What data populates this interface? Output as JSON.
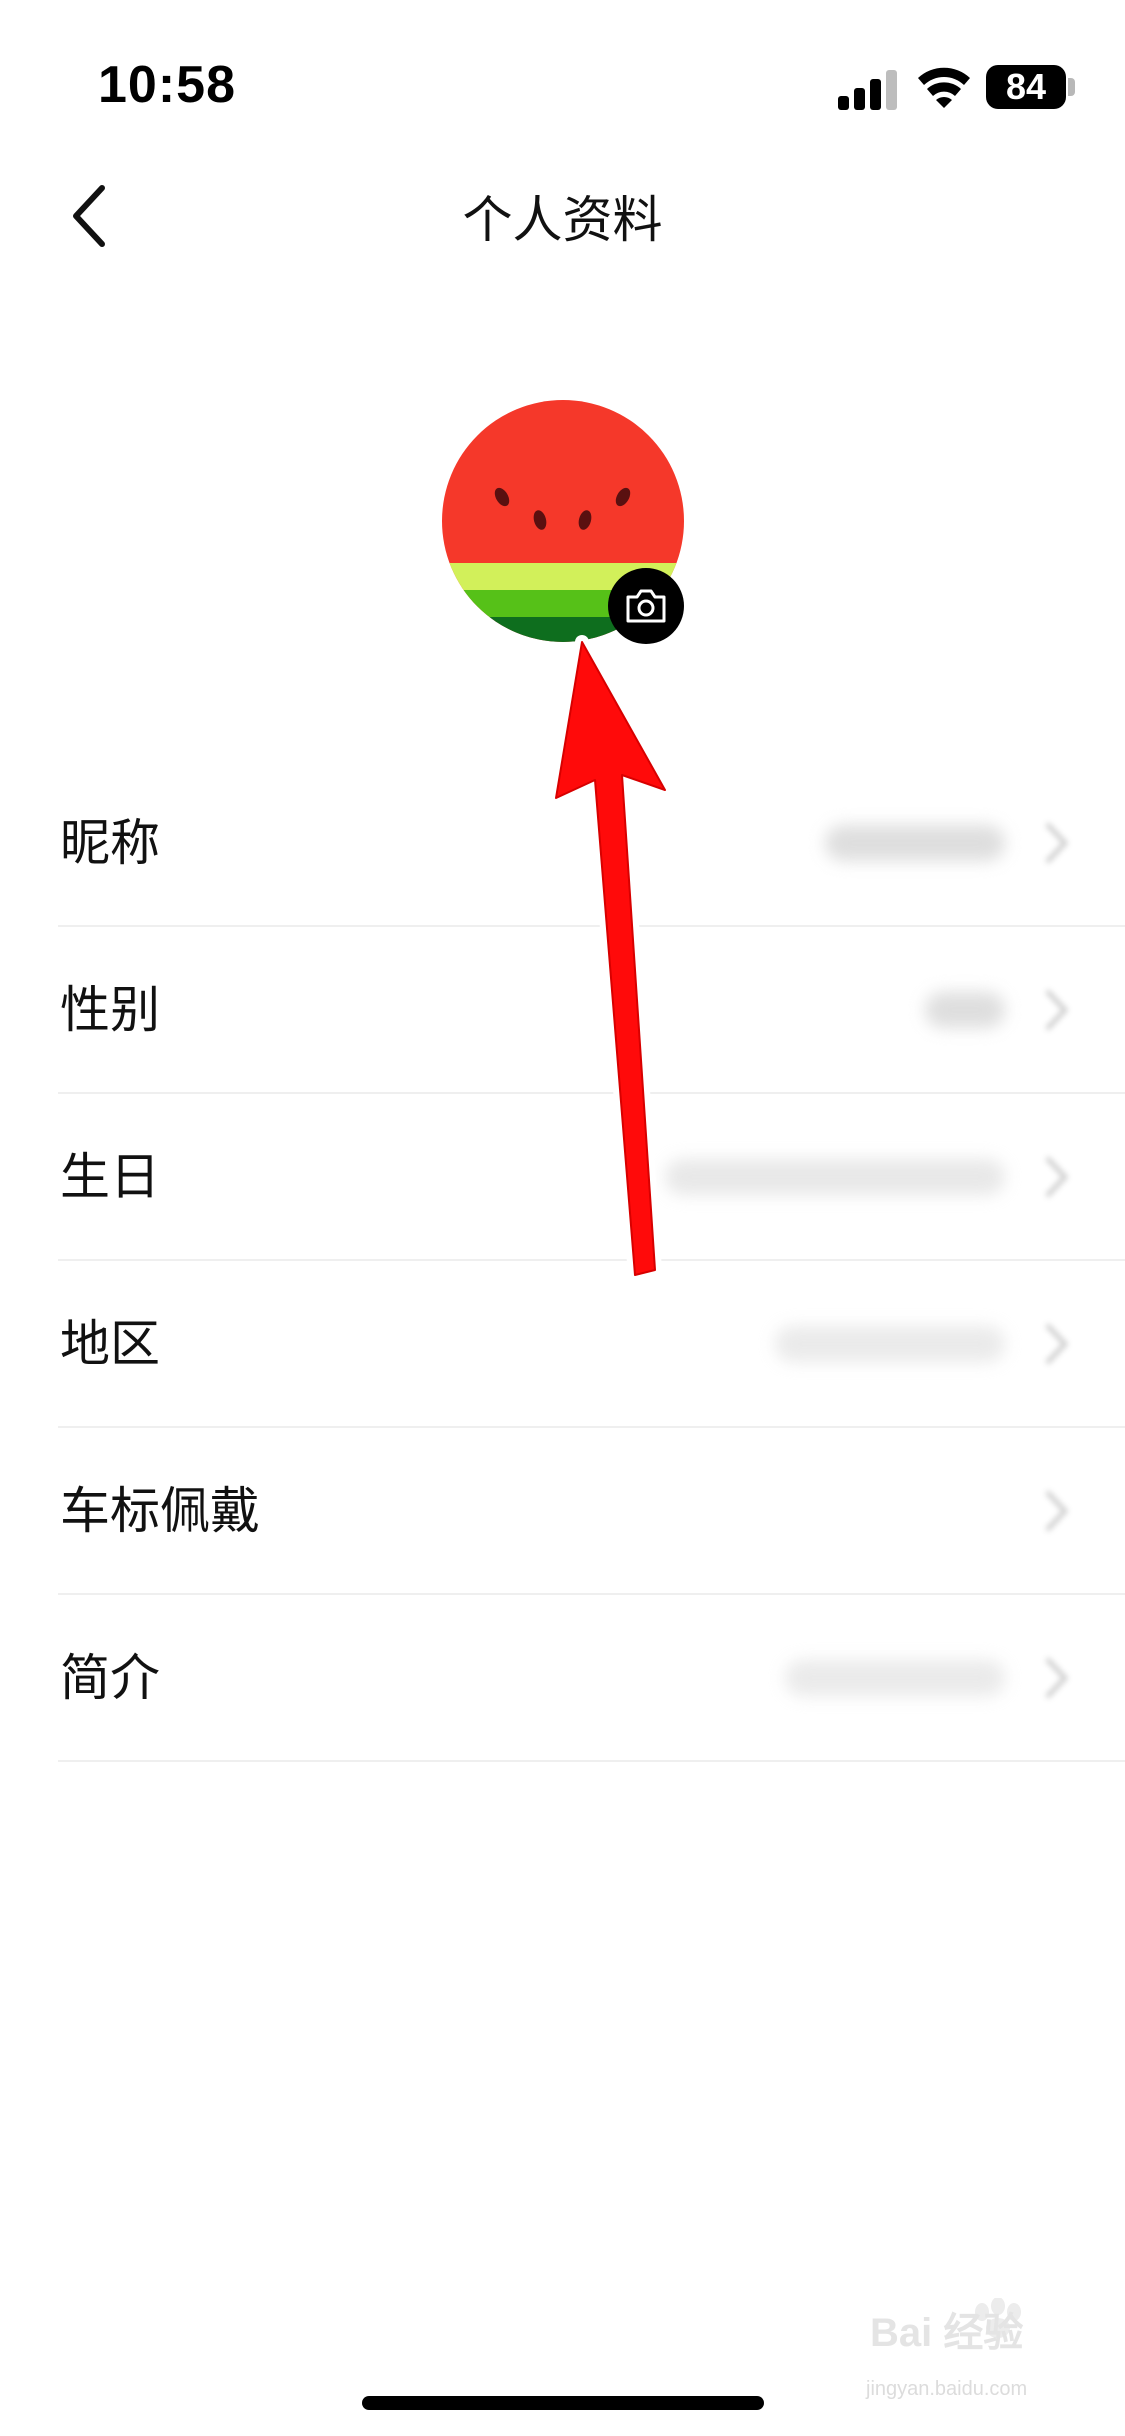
{
  "status_bar": {
    "time": "10:58",
    "battery": "84",
    "icons": [
      "signal-icon",
      "wifi-icon",
      "battery-icon"
    ]
  },
  "nav": {
    "title": "个人资料",
    "back_icon": "chevron-left-icon"
  },
  "avatar": {
    "image": "watermelon-slice-avatar",
    "badge_icon": "camera-icon"
  },
  "profile_fields": [
    {
      "label": "昵称"
    },
    {
      "label": "性别"
    },
    {
      "label": "生日"
    },
    {
      "label": "地区"
    },
    {
      "label": "车标佩戴"
    },
    {
      "label": "简介"
    }
  ],
  "annotation": {
    "type": "red-arrow",
    "color": "#ff0000",
    "points_to": "avatar-camera-badge"
  },
  "watermark": {
    "brand": "Bai 经验",
    "sub": "jingyan.baidu.com"
  },
  "colors": {
    "watermelon_red": "#f5382a",
    "rind_light": "#d2f05a",
    "rind_mid": "#56c118",
    "rind_dark": "#0e6e1e"
  }
}
